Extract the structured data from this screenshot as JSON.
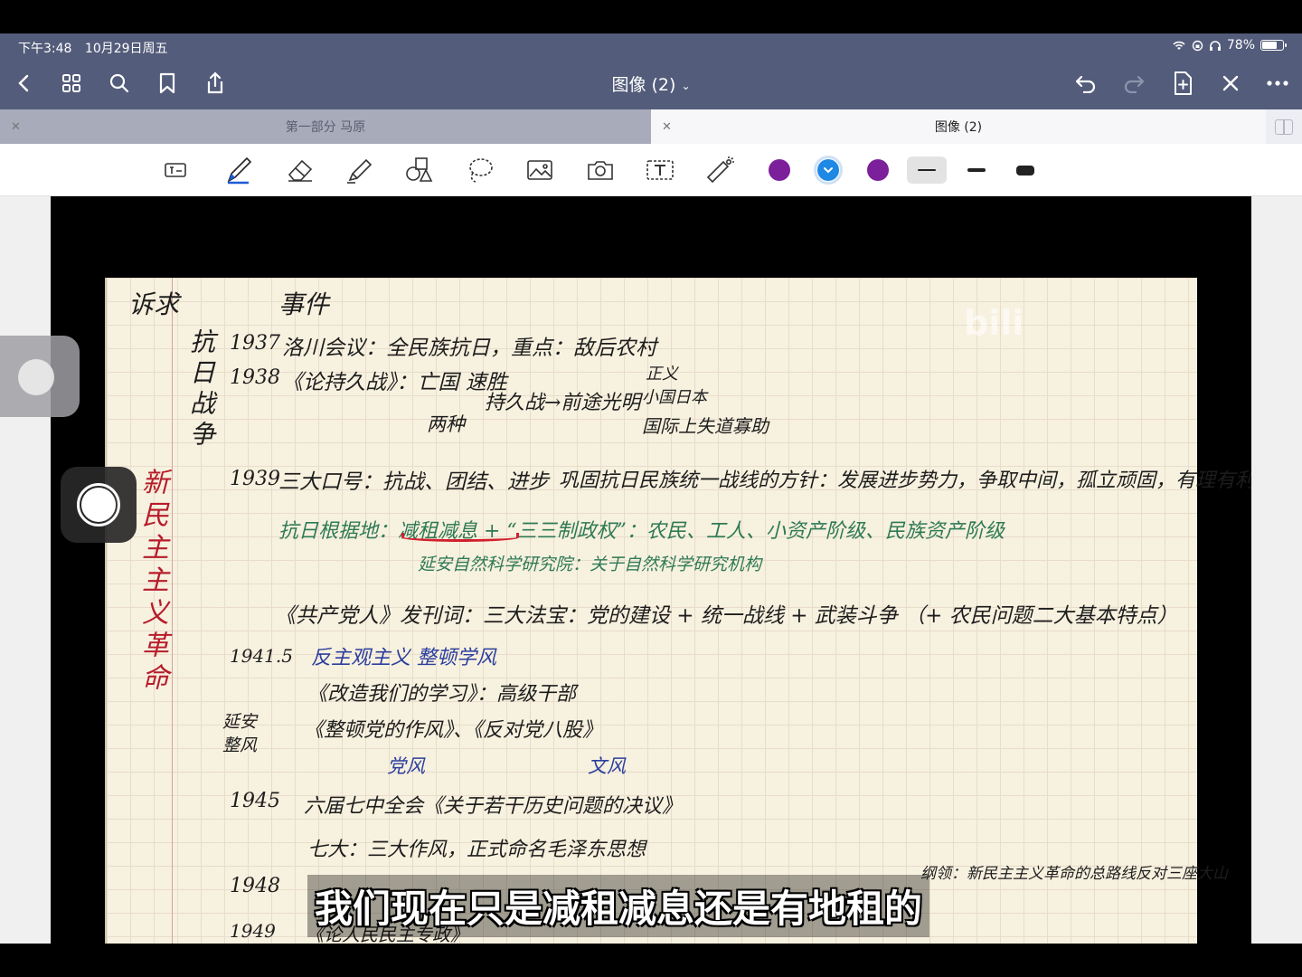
{
  "status": {
    "time": "下午3:48",
    "date": "10月29日周五",
    "battery": "78%",
    "battery_level": 0.78
  },
  "nav": {
    "title": "图像 (2)",
    "back_icon": "chevron-left-icon",
    "grid_icon": "grid-icon",
    "search_icon": "search-icon",
    "bookmark_icon": "bookmark-icon",
    "share_icon": "share-icon",
    "undo_icon": "undo-icon",
    "redo_icon": "redo-icon",
    "add_page_icon": "add-page-icon",
    "close_icon": "close-icon",
    "more_icon": "more-icon"
  },
  "tabs": [
    {
      "label": "第一部分 马原",
      "active": false
    },
    {
      "label": "图像 (2)",
      "active": true
    }
  ],
  "toolbar": {
    "tools": [
      "shape-tool-icon",
      "pen-icon",
      "eraser-icon",
      "highlighter-icon",
      "shapes-icon",
      "lasso-icon",
      "image-icon",
      "camera-icon",
      "text-icon",
      "laser-pointer-icon"
    ],
    "colors": [
      "#7b1f9a",
      "#1e88e5",
      "#7b1f9a"
    ],
    "selected_color": 1,
    "thickness_selected": 0
  },
  "note": {
    "header_left": "诉求",
    "header_right": "事件",
    "vertical_war": "抗日战争",
    "vertical_revolution": "新民主主义革命",
    "lines": [
      {
        "year": "1937",
        "text": "洛川会议：全民族抗日，重点：敌后农村"
      },
      {
        "year": "1938",
        "text": "《论持久战》：亡国 速胜"
      },
      {
        "year": "",
        "text": "两种"
      },
      {
        "year": "",
        "text": "持久战→前途光明"
      },
      {
        "year": "",
        "text": "正义"
      },
      {
        "year": "",
        "text": "小国日本"
      },
      {
        "year": "",
        "text": "国际上失道寡助"
      },
      {
        "year": "1939",
        "text": "三大口号：抗战、团结、进步"
      },
      {
        "year": "",
        "text": "巩固抗日民族统一战线的方针：发展进步势力，争取中间，孤立顽固，有理有利有节"
      },
      {
        "year": "",
        "text": "抗日根据地：减租减息 + “三三制政权”：农民、工人、小资产阶级、民族资产阶级"
      },
      {
        "year": "",
        "text": "延安自然科学研究院：关于自然科学研究机构"
      },
      {
        "year": "",
        "text": "《共产党人》发刊词：三大法宝：党的建设 + 统一战线 + 武装斗争 （+ 农民问题二大基本特点）"
      },
      {
        "year": "1941.5",
        "text": "反主观主义 整顿学风"
      },
      {
        "year": "",
        "text": "《改造我们的学习》：高级干部"
      },
      {
        "year": "延安整风",
        "text": "《整顿党的作风》、《反对党八股》"
      },
      {
        "year": "",
        "text": "党风"
      },
      {
        "year": "",
        "text": "文风"
      },
      {
        "year": "1945",
        "text": "六届七中全会《关于若干历史问题的决议》"
      },
      {
        "year": "",
        "text": "七大：三大作风，正式命名毛泽东思想"
      },
      {
        "year": "1948",
        "text": "纲领：新民主主义革命的总路线反对三座大山"
      },
      {
        "year": "1949",
        "text": "《论人民民主专政》"
      }
    ]
  },
  "watermark": "bili",
  "subtitle": "我们现在只是减租减息还是有地租的"
}
